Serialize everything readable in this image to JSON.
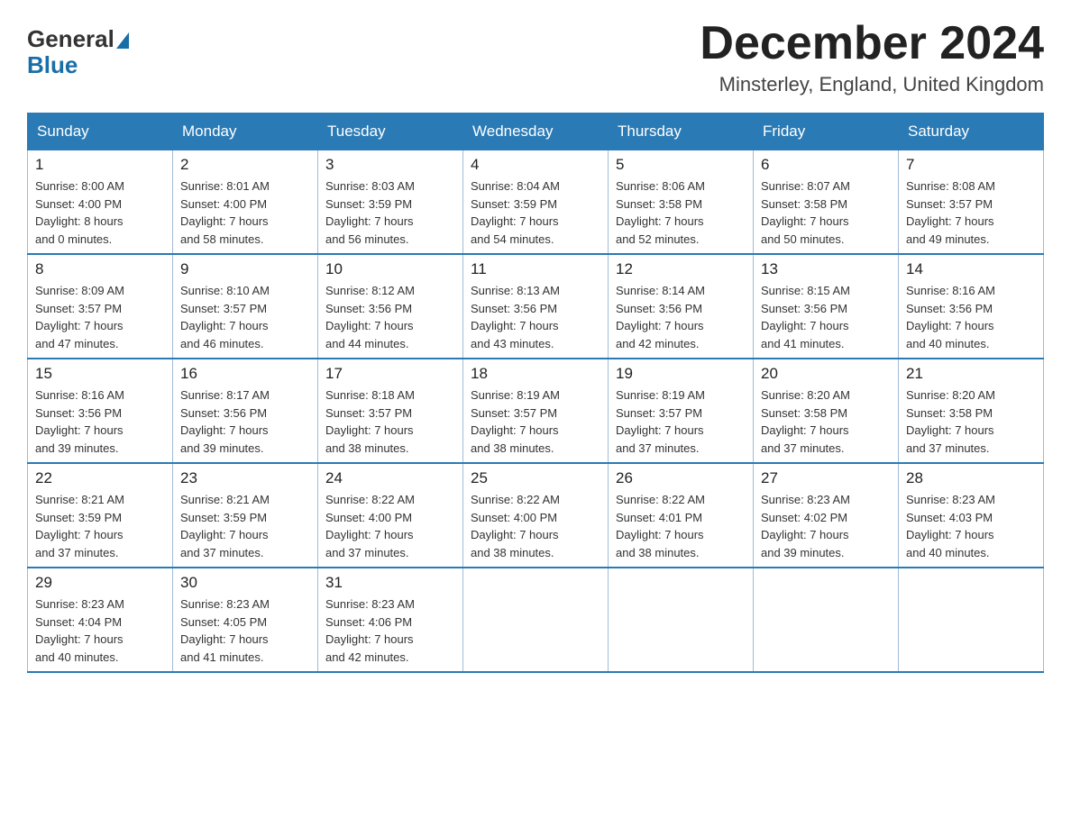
{
  "logo": {
    "general": "General",
    "blue": "Blue"
  },
  "title": "December 2024",
  "subtitle": "Minsterley, England, United Kingdom",
  "headers": [
    "Sunday",
    "Monday",
    "Tuesday",
    "Wednesday",
    "Thursday",
    "Friday",
    "Saturday"
  ],
  "weeks": [
    [
      {
        "day": "1",
        "info": "Sunrise: 8:00 AM\nSunset: 4:00 PM\nDaylight: 8 hours\nand 0 minutes."
      },
      {
        "day": "2",
        "info": "Sunrise: 8:01 AM\nSunset: 4:00 PM\nDaylight: 7 hours\nand 58 minutes."
      },
      {
        "day": "3",
        "info": "Sunrise: 8:03 AM\nSunset: 3:59 PM\nDaylight: 7 hours\nand 56 minutes."
      },
      {
        "day": "4",
        "info": "Sunrise: 8:04 AM\nSunset: 3:59 PM\nDaylight: 7 hours\nand 54 minutes."
      },
      {
        "day": "5",
        "info": "Sunrise: 8:06 AM\nSunset: 3:58 PM\nDaylight: 7 hours\nand 52 minutes."
      },
      {
        "day": "6",
        "info": "Sunrise: 8:07 AM\nSunset: 3:58 PM\nDaylight: 7 hours\nand 50 minutes."
      },
      {
        "day": "7",
        "info": "Sunrise: 8:08 AM\nSunset: 3:57 PM\nDaylight: 7 hours\nand 49 minutes."
      }
    ],
    [
      {
        "day": "8",
        "info": "Sunrise: 8:09 AM\nSunset: 3:57 PM\nDaylight: 7 hours\nand 47 minutes."
      },
      {
        "day": "9",
        "info": "Sunrise: 8:10 AM\nSunset: 3:57 PM\nDaylight: 7 hours\nand 46 minutes."
      },
      {
        "day": "10",
        "info": "Sunrise: 8:12 AM\nSunset: 3:56 PM\nDaylight: 7 hours\nand 44 minutes."
      },
      {
        "day": "11",
        "info": "Sunrise: 8:13 AM\nSunset: 3:56 PM\nDaylight: 7 hours\nand 43 minutes."
      },
      {
        "day": "12",
        "info": "Sunrise: 8:14 AM\nSunset: 3:56 PM\nDaylight: 7 hours\nand 42 minutes."
      },
      {
        "day": "13",
        "info": "Sunrise: 8:15 AM\nSunset: 3:56 PM\nDaylight: 7 hours\nand 41 minutes."
      },
      {
        "day": "14",
        "info": "Sunrise: 8:16 AM\nSunset: 3:56 PM\nDaylight: 7 hours\nand 40 minutes."
      }
    ],
    [
      {
        "day": "15",
        "info": "Sunrise: 8:16 AM\nSunset: 3:56 PM\nDaylight: 7 hours\nand 39 minutes."
      },
      {
        "day": "16",
        "info": "Sunrise: 8:17 AM\nSunset: 3:56 PM\nDaylight: 7 hours\nand 39 minutes."
      },
      {
        "day": "17",
        "info": "Sunrise: 8:18 AM\nSunset: 3:57 PM\nDaylight: 7 hours\nand 38 minutes."
      },
      {
        "day": "18",
        "info": "Sunrise: 8:19 AM\nSunset: 3:57 PM\nDaylight: 7 hours\nand 38 minutes."
      },
      {
        "day": "19",
        "info": "Sunrise: 8:19 AM\nSunset: 3:57 PM\nDaylight: 7 hours\nand 37 minutes."
      },
      {
        "day": "20",
        "info": "Sunrise: 8:20 AM\nSunset: 3:58 PM\nDaylight: 7 hours\nand 37 minutes."
      },
      {
        "day": "21",
        "info": "Sunrise: 8:20 AM\nSunset: 3:58 PM\nDaylight: 7 hours\nand 37 minutes."
      }
    ],
    [
      {
        "day": "22",
        "info": "Sunrise: 8:21 AM\nSunset: 3:59 PM\nDaylight: 7 hours\nand 37 minutes."
      },
      {
        "day": "23",
        "info": "Sunrise: 8:21 AM\nSunset: 3:59 PM\nDaylight: 7 hours\nand 37 minutes."
      },
      {
        "day": "24",
        "info": "Sunrise: 8:22 AM\nSunset: 4:00 PM\nDaylight: 7 hours\nand 37 minutes."
      },
      {
        "day": "25",
        "info": "Sunrise: 8:22 AM\nSunset: 4:00 PM\nDaylight: 7 hours\nand 38 minutes."
      },
      {
        "day": "26",
        "info": "Sunrise: 8:22 AM\nSunset: 4:01 PM\nDaylight: 7 hours\nand 38 minutes."
      },
      {
        "day": "27",
        "info": "Sunrise: 8:23 AM\nSunset: 4:02 PM\nDaylight: 7 hours\nand 39 minutes."
      },
      {
        "day": "28",
        "info": "Sunrise: 8:23 AM\nSunset: 4:03 PM\nDaylight: 7 hours\nand 40 minutes."
      }
    ],
    [
      {
        "day": "29",
        "info": "Sunrise: 8:23 AM\nSunset: 4:04 PM\nDaylight: 7 hours\nand 40 minutes."
      },
      {
        "day": "30",
        "info": "Sunrise: 8:23 AM\nSunset: 4:05 PM\nDaylight: 7 hours\nand 41 minutes."
      },
      {
        "day": "31",
        "info": "Sunrise: 8:23 AM\nSunset: 4:06 PM\nDaylight: 7 hours\nand 42 minutes."
      },
      null,
      null,
      null,
      null
    ]
  ]
}
